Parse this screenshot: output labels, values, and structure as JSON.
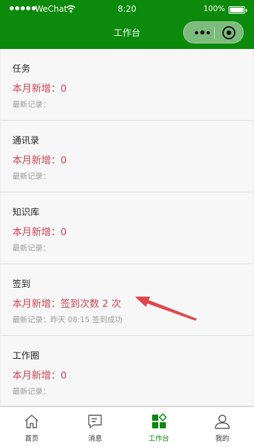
{
  "status_bar": {
    "carrier": "WeChat",
    "time": "8:20",
    "battery": "100%",
    "battery_level": 1.0
  },
  "nav": {
    "title": "工作台"
  },
  "cards": [
    {
      "title": "任务",
      "count": "本月新增：0",
      "latest": "最新记录："
    },
    {
      "title": "通讯录",
      "count": "本月新增：0",
      "latest": "最新记录："
    },
    {
      "title": "知识库",
      "count": "本月新增：0",
      "latest": "最新记录："
    },
    {
      "title": "签到",
      "count": "本月新增：签到次数 2 次",
      "latest": "最新记录：昨天 08:15 签到成功"
    },
    {
      "title": "工作圈",
      "count": "本月新增：0",
      "latest": "最新记录："
    }
  ],
  "tabs": [
    {
      "label": "首页",
      "icon": "home-icon"
    },
    {
      "label": "消息",
      "icon": "message-icon"
    },
    {
      "label": "工作台",
      "icon": "workbench-icon",
      "active": true
    },
    {
      "label": "我的",
      "icon": "user-icon"
    }
  ],
  "colors": {
    "header_green": "#0b8a0b",
    "count_red": "#c9454f",
    "annotation_arrow": "#e0474d",
    "active_tab": "#0b8a0b"
  }
}
